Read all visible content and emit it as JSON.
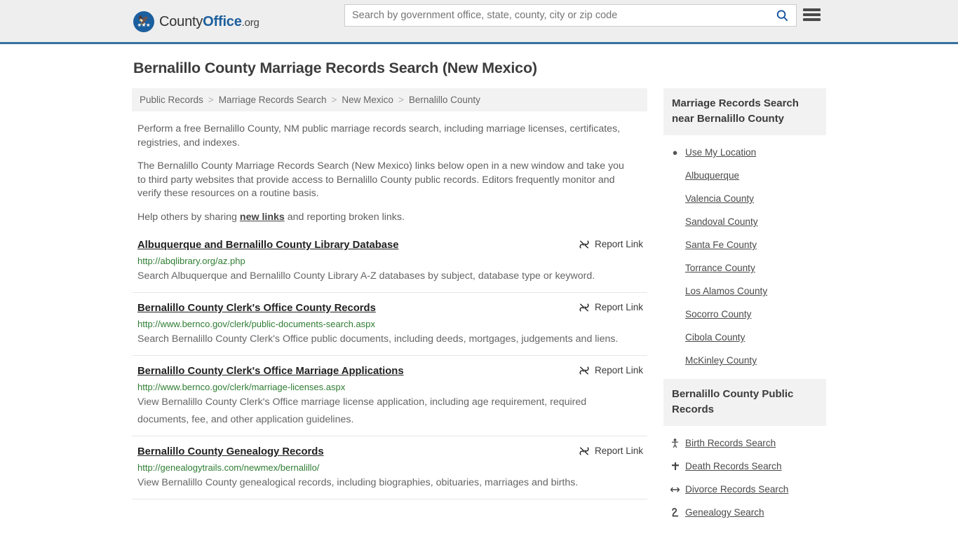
{
  "header": {
    "logo": {
      "part1": "County",
      "part2": "Office",
      "part3": ".org",
      "icon": "eagle-seal-icon"
    },
    "search": {
      "placeholder": "Search by government office, state, county, city or zip code",
      "value": "",
      "icon": "search-icon"
    },
    "menu_icon": "hamburger-menu-icon",
    "accent_color": "#36709f"
  },
  "page_title": "Bernalillo County Marriage Records Search (New Mexico)",
  "breadcrumb": {
    "items": [
      {
        "label": "Public Records"
      },
      {
        "label": "Marriage Records Search"
      },
      {
        "label": "New Mexico"
      },
      {
        "label": "Bernalillo County"
      }
    ],
    "separator": ">"
  },
  "intro": {
    "paragraph1": "Perform a free Bernalillo County, NM public marriage records search, including marriage licenses, certificates, registries, and indexes.",
    "paragraph2": "The Bernalillo County Marriage Records Search (New Mexico) links below open in a new window and take you to third party websites that provide access to Bernalillo County public records. Editors frequently monitor and verify these resources on a routine basis.",
    "paragraph3_pre": "Help others by sharing ",
    "paragraph3_link": "new links",
    "paragraph3_post": " and reporting broken links."
  },
  "results": {
    "report_label": "Report Link",
    "report_icon": "broken-link-icon",
    "items": [
      {
        "title": "Albuquerque and Bernalillo County Library Database",
        "url": "http://abqlibrary.org/az.php",
        "description": "Search Albuquerque and Bernalillo County Library A-Z databases by subject, database type or keyword."
      },
      {
        "title": "Bernalillo County Clerk's Office County Records",
        "url": "http://www.bernco.gov/clerk/public-documents-search.aspx",
        "description": "Search Bernalillo County Clerk's Office public documents, including deeds, mortgages, judgements and liens."
      },
      {
        "title": "Bernalillo County Clerk's Office Marriage Applications",
        "url": "http://www.bernco.gov/clerk/marriage-licenses.aspx",
        "description": "View Bernalillo County Clerk's Office marriage license application, including age requirement, required documents, fee, and other application guidelines."
      },
      {
        "title": "Bernalillo County Genealogy Records",
        "url": "http://genealogytrails.com/newmex/bernalillo/",
        "description": "View Bernalillo County genealogical records, including biographies, obituaries, marriages and births."
      }
    ]
  },
  "sidebar": {
    "nearby": {
      "heading": "Marriage Records Search near Bernalillo County",
      "items": [
        {
          "label": "Use My Location",
          "icon": "map-pin-icon"
        },
        {
          "label": "Albuquerque",
          "icon": ""
        },
        {
          "label": "Valencia County",
          "icon": ""
        },
        {
          "label": "Sandoval County",
          "icon": ""
        },
        {
          "label": "Santa Fe County",
          "icon": ""
        },
        {
          "label": "Torrance County",
          "icon": ""
        },
        {
          "label": "Los Alamos County",
          "icon": ""
        },
        {
          "label": "Socorro County",
          "icon": ""
        },
        {
          "label": "Cibola County",
          "icon": ""
        },
        {
          "label": "McKinley County",
          "icon": ""
        }
      ]
    },
    "public_records": {
      "heading": "Bernalillo County Public Records",
      "items": [
        {
          "label": "Birth Records Search",
          "icon": "baby-icon"
        },
        {
          "label": "Death Records Search",
          "icon": "cross-icon"
        },
        {
          "label": "Divorce Records Search",
          "icon": "left-right-arrow-icon"
        },
        {
          "label": "Genealogy Search",
          "icon": "family-tree-icon"
        }
      ]
    }
  }
}
